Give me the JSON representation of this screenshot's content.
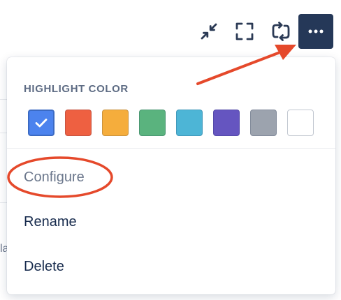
{
  "toolbar": {
    "buttons": [
      {
        "name": "minimize",
        "icon": "minimize-arrows-icon"
      },
      {
        "name": "fullscreen",
        "icon": "fullscreen-corners-icon"
      },
      {
        "name": "refresh",
        "icon": "refresh-arrows-icon"
      }
    ],
    "more_button": {
      "icon": "ellipsis-icon"
    }
  },
  "background": {
    "partial_text": "la"
  },
  "menu": {
    "highlight_section": {
      "title": "HIGHLIGHT COLOR",
      "selected_index": 0,
      "colors": [
        {
          "name": "blue",
          "hex": "#4c83ee"
        },
        {
          "name": "red",
          "hex": "#ee6041"
        },
        {
          "name": "yellow",
          "hex": "#f5ad3c"
        },
        {
          "name": "green",
          "hex": "#5ab37e"
        },
        {
          "name": "teal",
          "hex": "#4db5d6"
        },
        {
          "name": "purple",
          "hex": "#6555c0"
        },
        {
          "name": "gray",
          "hex": "#9ca3ae"
        },
        {
          "name": "white",
          "hex": "#ffffff"
        }
      ]
    },
    "items": [
      {
        "label": "Configure"
      },
      {
        "label": "Rename"
      },
      {
        "label": "Delete"
      }
    ]
  },
  "colors": {
    "more_button_bg": "#253858",
    "annotation": "#e5492b",
    "text_primary": "#172b4d",
    "text_muted": "#6b778c"
  }
}
